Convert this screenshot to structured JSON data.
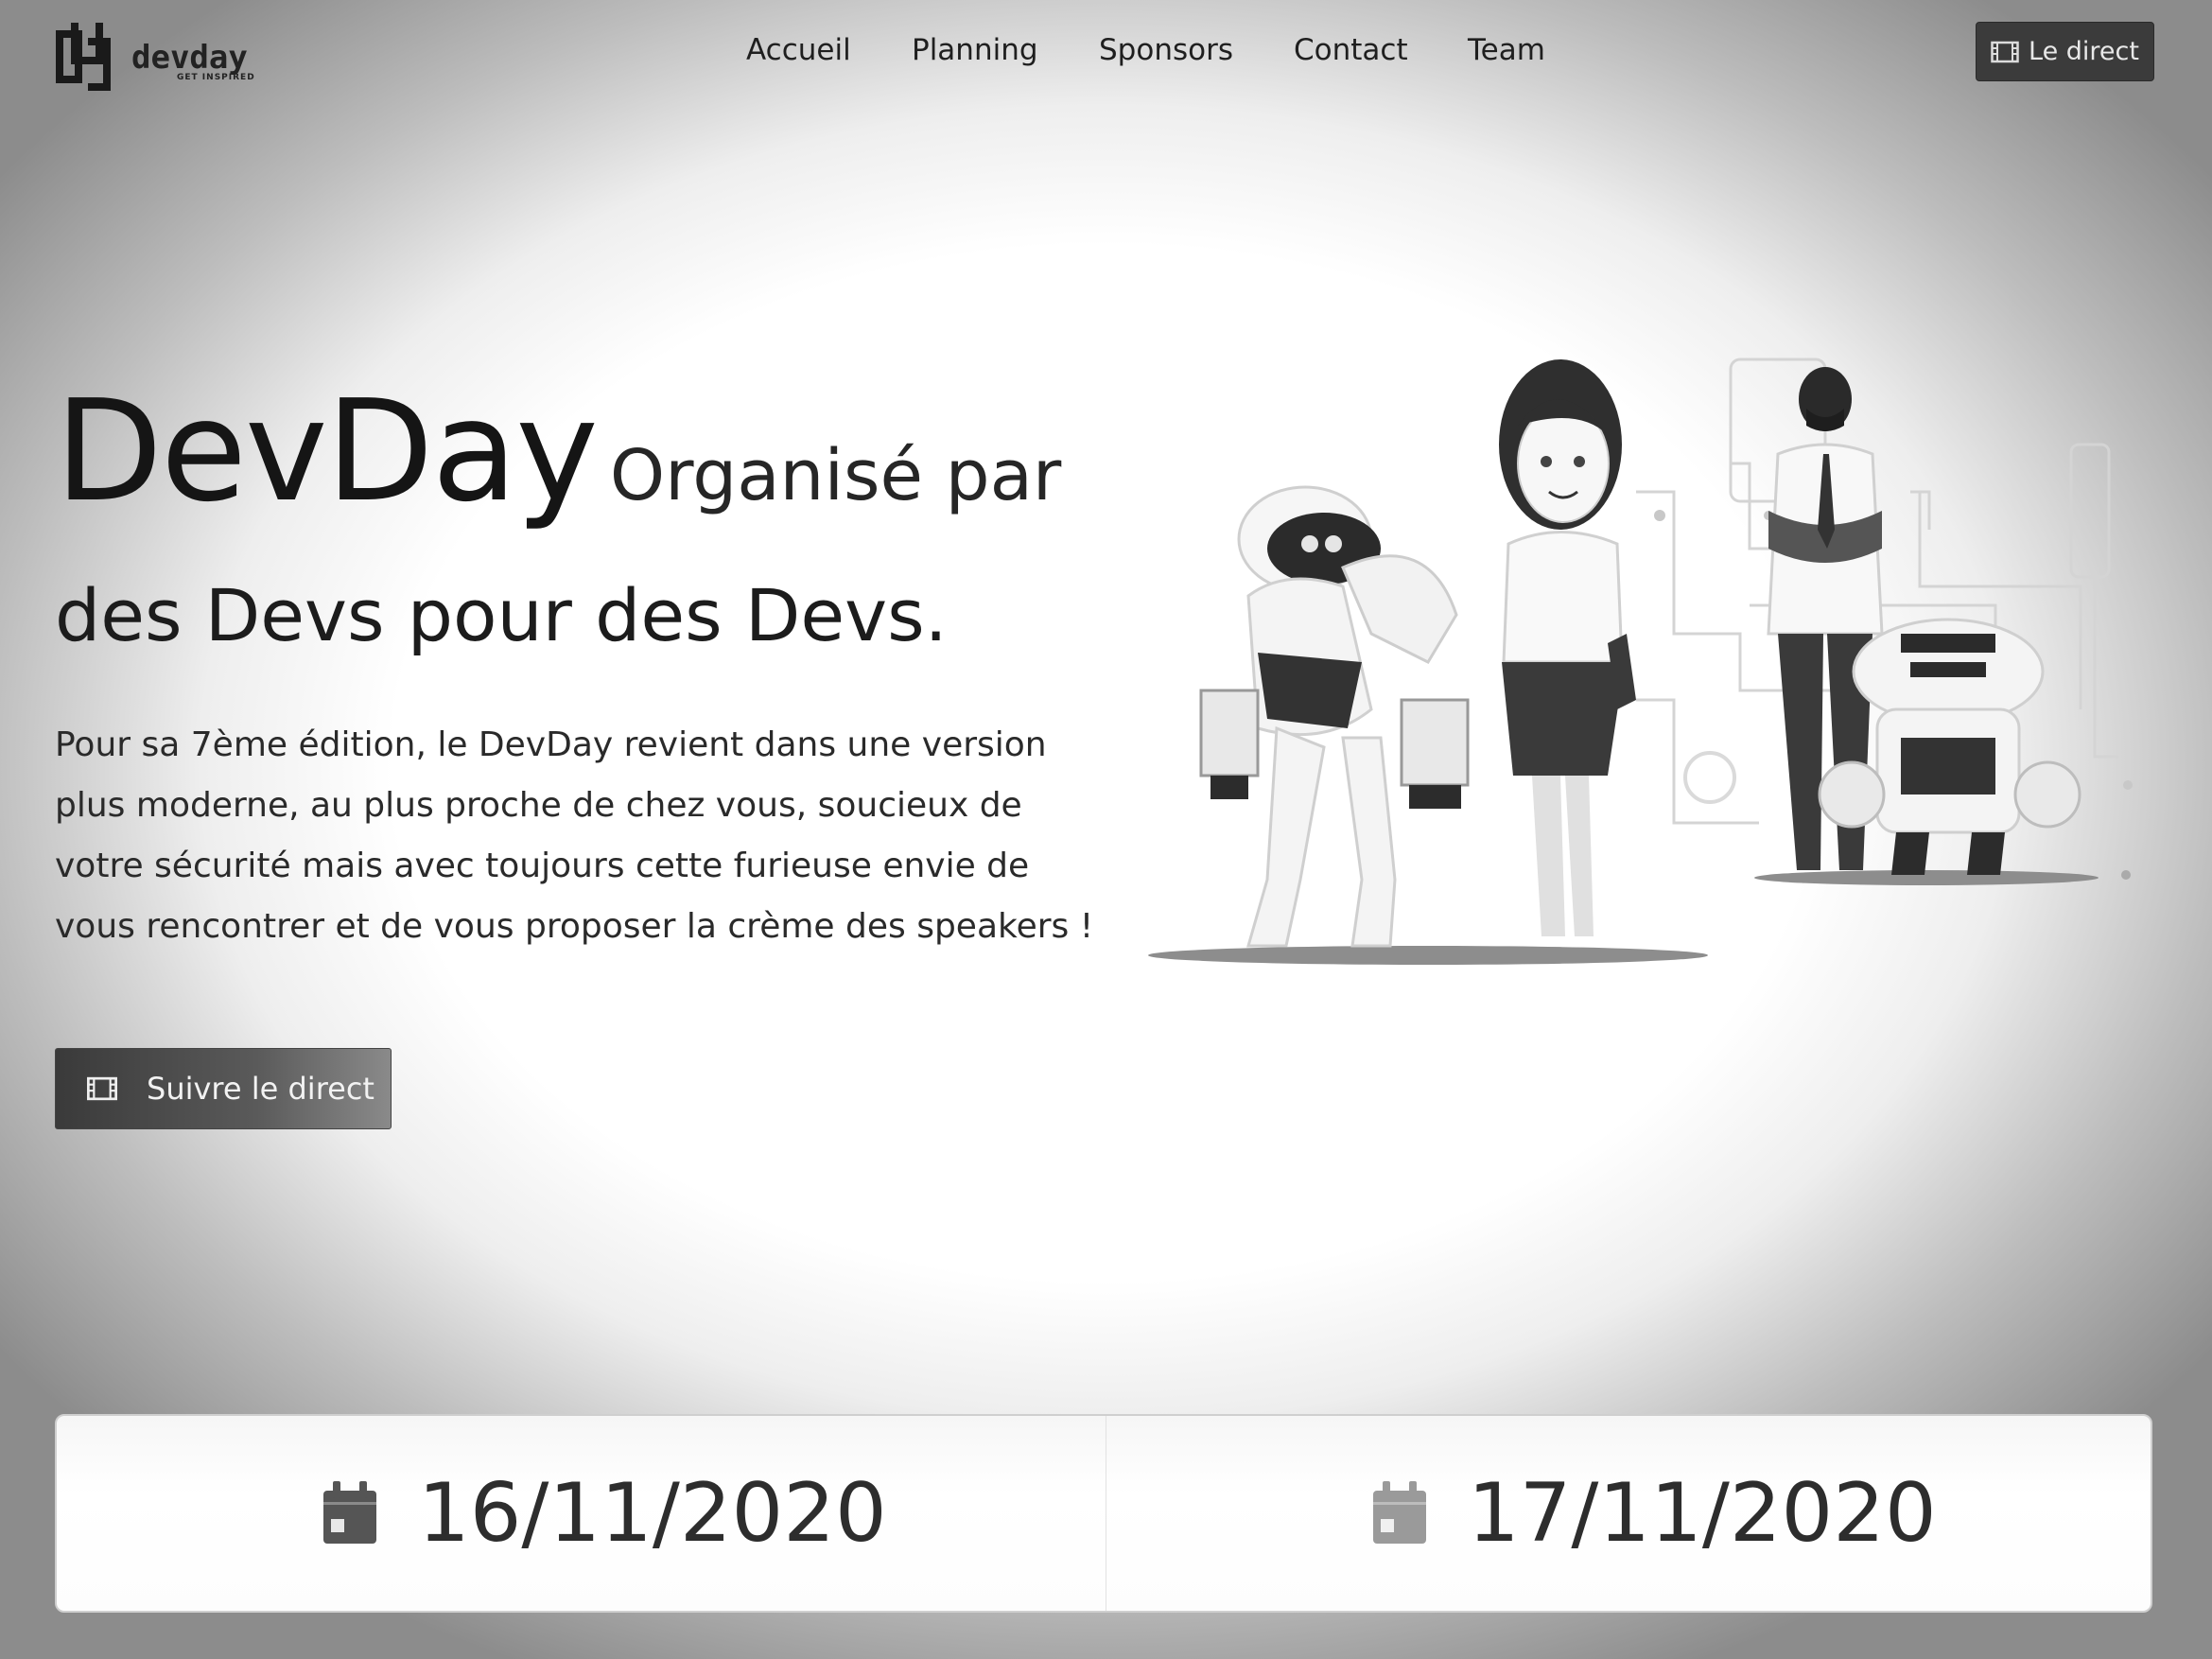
{
  "header": {
    "logo_text": "devday",
    "logo_tagline": "GET INSPIRED",
    "nav": {
      "accueil": "Accueil",
      "planning": "Planning",
      "sponsors": "Sponsors",
      "contact": "Contact",
      "team": "Team"
    },
    "live_button": "Le direct"
  },
  "hero": {
    "brand": "DevDay",
    "tagline_part1": "Organisé par",
    "tagline_part2": "des Devs pour des Devs.",
    "description": "Pour sa 7ème édition, le DevDay revient dans une version plus moderne, au plus proche de chez vous, soucieux de votre sécurité mais avec toujours cette furieuse envie de vous rencontrer et de vous proposer la crème des speakers !",
    "cta_label": "Suivre le direct"
  },
  "dates": [
    {
      "label": "16/11/2020",
      "icon": "calendar-icon",
      "color": "#555555"
    },
    {
      "label": "17/11/2020",
      "icon": "calendar-icon",
      "color": "#9a9a9a"
    }
  ],
  "icons": {
    "live": "film-icon",
    "cta": "film-icon"
  }
}
